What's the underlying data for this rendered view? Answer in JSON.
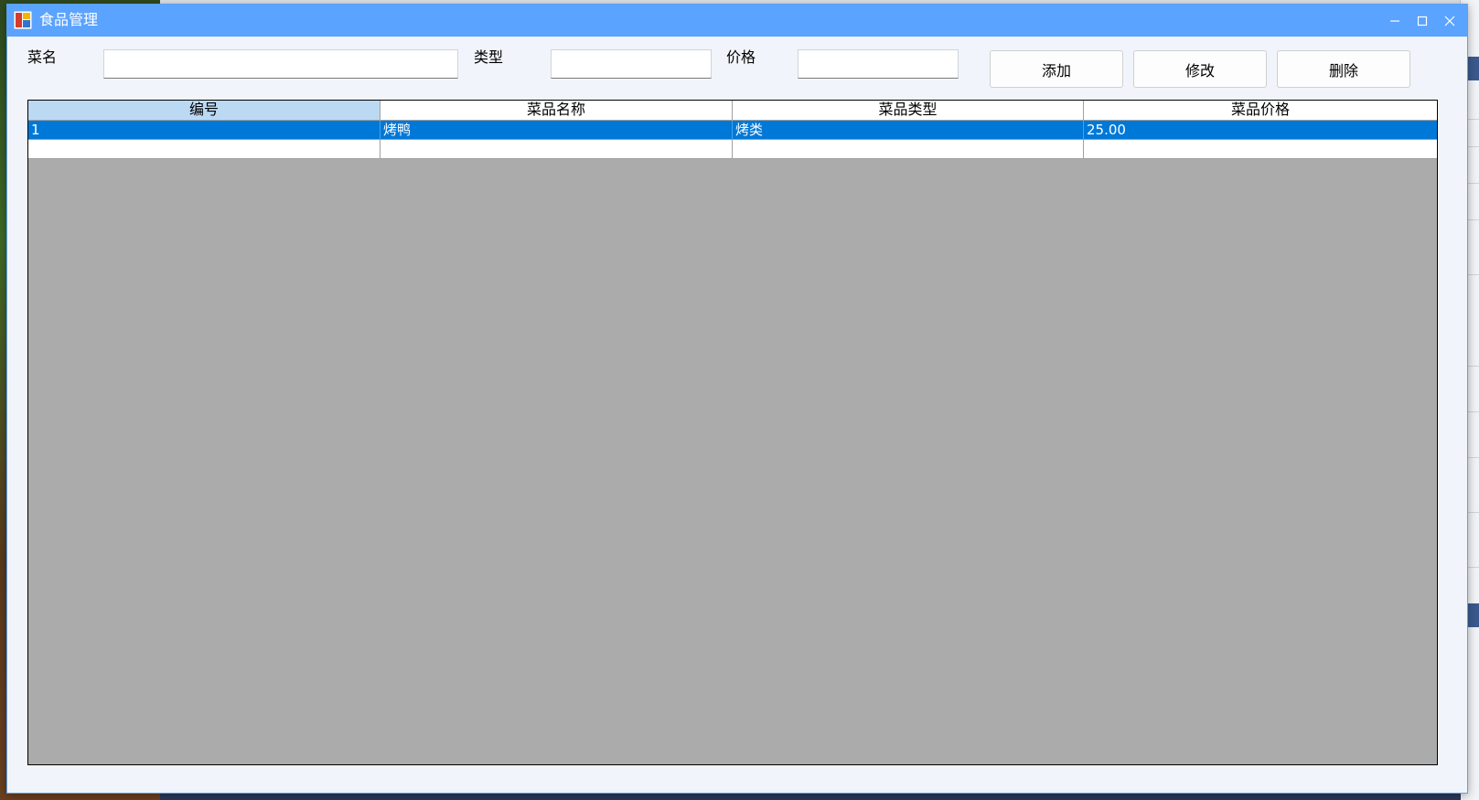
{
  "window": {
    "title": "食品管理"
  },
  "form": {
    "name_label": "菜名",
    "name_value": "",
    "type_label": "类型",
    "type_value": "",
    "price_label": "价格",
    "price_value": ""
  },
  "buttons": {
    "add": "添加",
    "edit": "修改",
    "delete": "删除"
  },
  "grid": {
    "columns": [
      "编号",
      "菜品名称",
      "菜品类型",
      "菜品价格"
    ],
    "rows": [
      [
        "1",
        "烤鸭",
        "烤类",
        "25.00"
      ]
    ]
  },
  "colors": {
    "titlebar": "#5aa3ff",
    "selection": "#0078d7",
    "grid_background": "#ababab",
    "header_selected": "#bcd9f4"
  }
}
